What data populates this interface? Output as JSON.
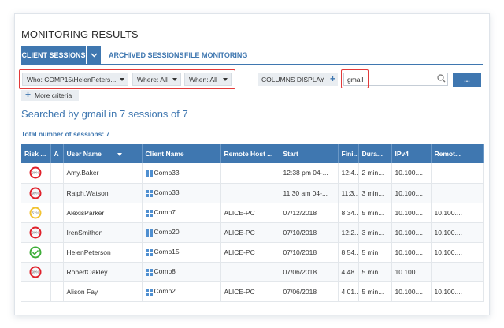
{
  "title": "MONITORING RESULTS",
  "tabs": {
    "active": "CLIENT SESSIONS",
    "archived": "ARCHIVED SESSIONS",
    "file": "FILE MONITORING"
  },
  "filters": {
    "who": "Who: COMP15\\HelenPeters...",
    "where": "Where: All",
    "when": "When: All"
  },
  "columns_display": "COLUMNS DISPLAY",
  "search": {
    "value": "gmail"
  },
  "go_button": "...",
  "more_criteria": "More criteria",
  "headline": "Searched by gmail in 7 sessions of 7",
  "total": "Total number of sessions: 7",
  "colors": {
    "accent": "#3f77b0",
    "highlight": "#e23a3a",
    "risk_high": "#e0202a",
    "risk_mid": "#f2c230",
    "risk_ok": "#3fae3a"
  },
  "table": {
    "headers": [
      "Risk ...",
      "A",
      "User Name",
      "Client Name",
      "Remote Host ...",
      "Start",
      "Fini...",
      "Dura...",
      "IPv4",
      "Remot..."
    ],
    "rows": [
      {
        "risk_label": "99%",
        "risk": "high",
        "user": "Amy.Baker",
        "client": "Comp33",
        "remote_host": "",
        "start": "12:38 pm 04-...",
        "finish": "12:4...",
        "duration": "2 min...",
        "ipv4": "10.100....",
        "remote_ip": ""
      },
      {
        "risk_label": "99%",
        "risk": "high",
        "user": "Ralph.Watson",
        "client": "Comp33",
        "remote_host": "",
        "start": "11:30 am 04-...",
        "finish": "11:3...",
        "duration": "3 min...",
        "ipv4": "10.100....",
        "remote_ip": ""
      },
      {
        "risk_label": "51%",
        "risk": "mid",
        "user": "AlexisParker",
        "client": "Comp7",
        "remote_host": "ALICE-PC",
        "start": "07/12/2018",
        "finish": "8:34...",
        "duration": "5 min...",
        "ipv4": "10.100....",
        "remote_ip": "10.100...."
      },
      {
        "risk_label": "90%",
        "risk": "high",
        "user": "IrenSmithon",
        "client": "Comp20",
        "remote_host": "ALICE-PC",
        "start": "07/10/2018",
        "finish": "12:2...",
        "duration": "3 min...",
        "ipv4": "10.100....",
        "remote_ip": "10.100...."
      },
      {
        "risk_label": "",
        "risk": "ok",
        "user": "HelenPeterson",
        "client": "Comp15",
        "remote_host": "ALICE-PC",
        "start": "07/10/2018",
        "finish": "8:54...",
        "duration": "5 min",
        "ipv4": "10.100....",
        "remote_ip": "10.100...."
      },
      {
        "risk_label": "99%",
        "risk": "high",
        "user": "RobertOakley",
        "client": "Comp8",
        "remote_host": "",
        "start": "07/06/2018",
        "finish": "4:48...",
        "duration": "5 min...",
        "ipv4": "10.100....",
        "remote_ip": ""
      },
      {
        "risk_label": "",
        "risk": "none",
        "user": "Alison Fay",
        "client": "Comp2",
        "remote_host": "ALICE-PC",
        "start": "07/06/2018",
        "finish": "4:01...",
        "duration": "5 min...",
        "ipv4": "10.100....",
        "remote_ip": "10.100...."
      }
    ]
  }
}
